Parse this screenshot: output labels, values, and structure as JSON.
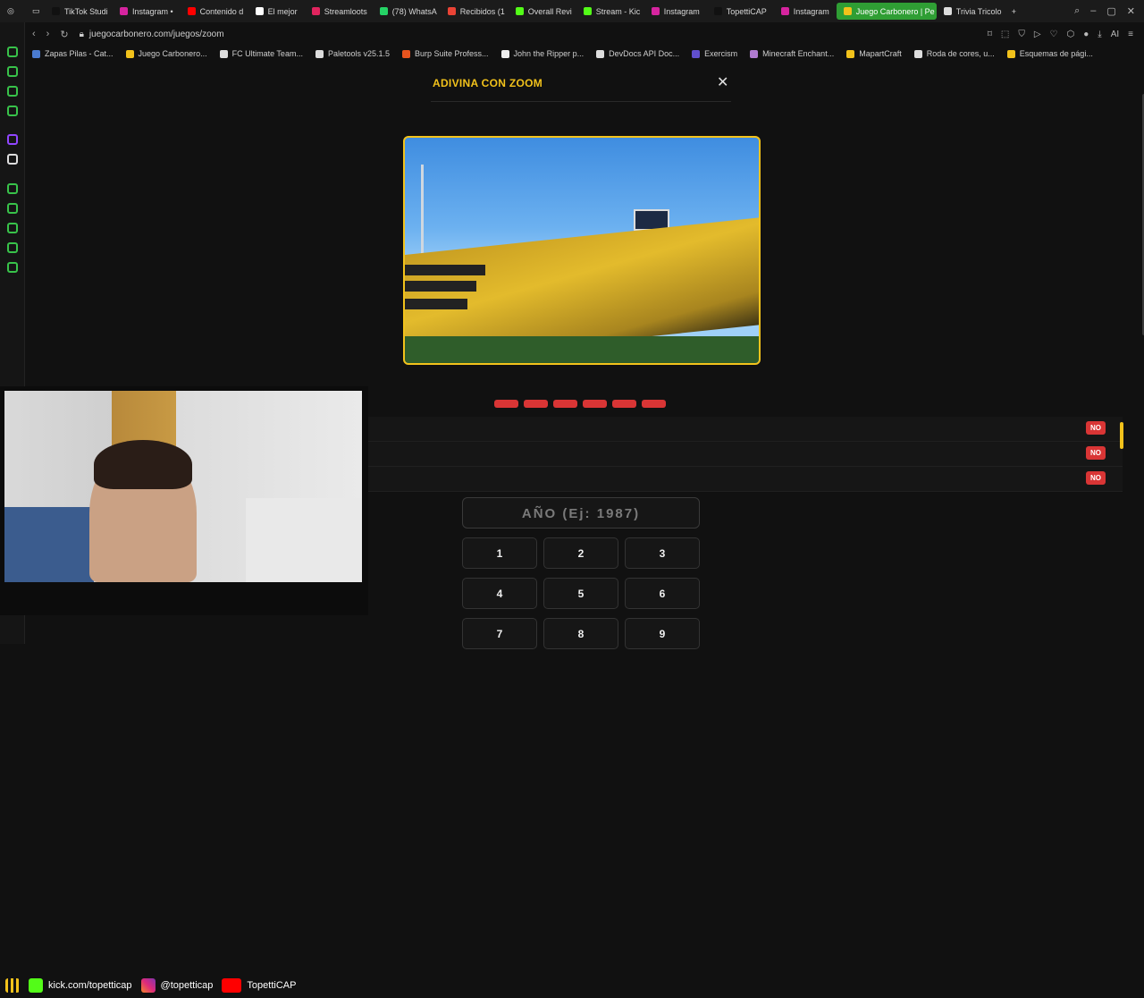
{
  "browser": {
    "tabs": [
      {
        "label": "TikTok Studi",
        "color": "#111111"
      },
      {
        "label": "Instagram •",
        "color": "#d6249f"
      },
      {
        "label": "Contenido d",
        "color": "#ff0000"
      },
      {
        "label": "El mejor",
        "color": "#ffffff"
      },
      {
        "label": "Streamloots",
        "color": "#e0245e"
      },
      {
        "label": "(78) WhatsA",
        "color": "#25d366"
      },
      {
        "label": "Recibidos (1",
        "color": "#ea4335"
      },
      {
        "label": "Overall Revi",
        "color": "#53fc18"
      },
      {
        "label": "Stream - Kic",
        "color": "#53fc18"
      },
      {
        "label": "Instagram",
        "color": "#d6249f"
      },
      {
        "label": "TopettiCAP",
        "color": "#111111"
      },
      {
        "label": "Instagram",
        "color": "#d6249f"
      },
      {
        "label": "Juego Carbonero | Pe",
        "color": "#f2c21b"
      },
      {
        "label": "Trivia Tricolo",
        "color": "#dddddd"
      }
    ],
    "active_tab_index": 12,
    "url": "juegocarbonero.com/juegos/zoom",
    "bookmarks": [
      {
        "label": "Zapas Pilas - Cat...",
        "color": "#4a7bd0"
      },
      {
        "label": "Juego Carbonero...",
        "color": "#f2c21b"
      },
      {
        "label": "FC Ultimate Team...",
        "color": "#dddddd"
      },
      {
        "label": "Paletools v25.1.5",
        "color": "#dddddd"
      },
      {
        "label": "Burp Suite Profess...",
        "color": "#e8541e"
      },
      {
        "label": "John the Ripper p...",
        "color": "#eeeeee"
      },
      {
        "label": "DevDocs API Doc...",
        "color": "#dddddd"
      },
      {
        "label": "Exercism",
        "color": "#604fcd"
      },
      {
        "label": "Minecraft Enchant...",
        "color": "#b07bd0"
      },
      {
        "label": "MapartCraft",
        "color": "#f2c21b"
      },
      {
        "label": "Roda de cores, u...",
        "color": "#dddddd"
      },
      {
        "label": "Esquemas de pági...",
        "color": "#f2c21b"
      }
    ]
  },
  "game": {
    "title": "ADIVINA CON ZOOM",
    "close_symbol": "✕",
    "attempts_total": 6,
    "answers": [
      {
        "badge": "NO"
      },
      {
        "badge": "NO"
      },
      {
        "badge": "NO"
      }
    ],
    "year_placeholder": "AÑO (Ej: 1987)",
    "keypad": [
      "1",
      "2",
      "3",
      "4",
      "5",
      "6",
      "7",
      "8",
      "9"
    ]
  },
  "overlay": {
    "kick": "kick.com/topetticap",
    "instagram": "@topetticap",
    "youtube": "TopettiCAP"
  },
  "colors": {
    "accent": "#f2c21b",
    "danger": "#d93535",
    "background": "#111111"
  }
}
